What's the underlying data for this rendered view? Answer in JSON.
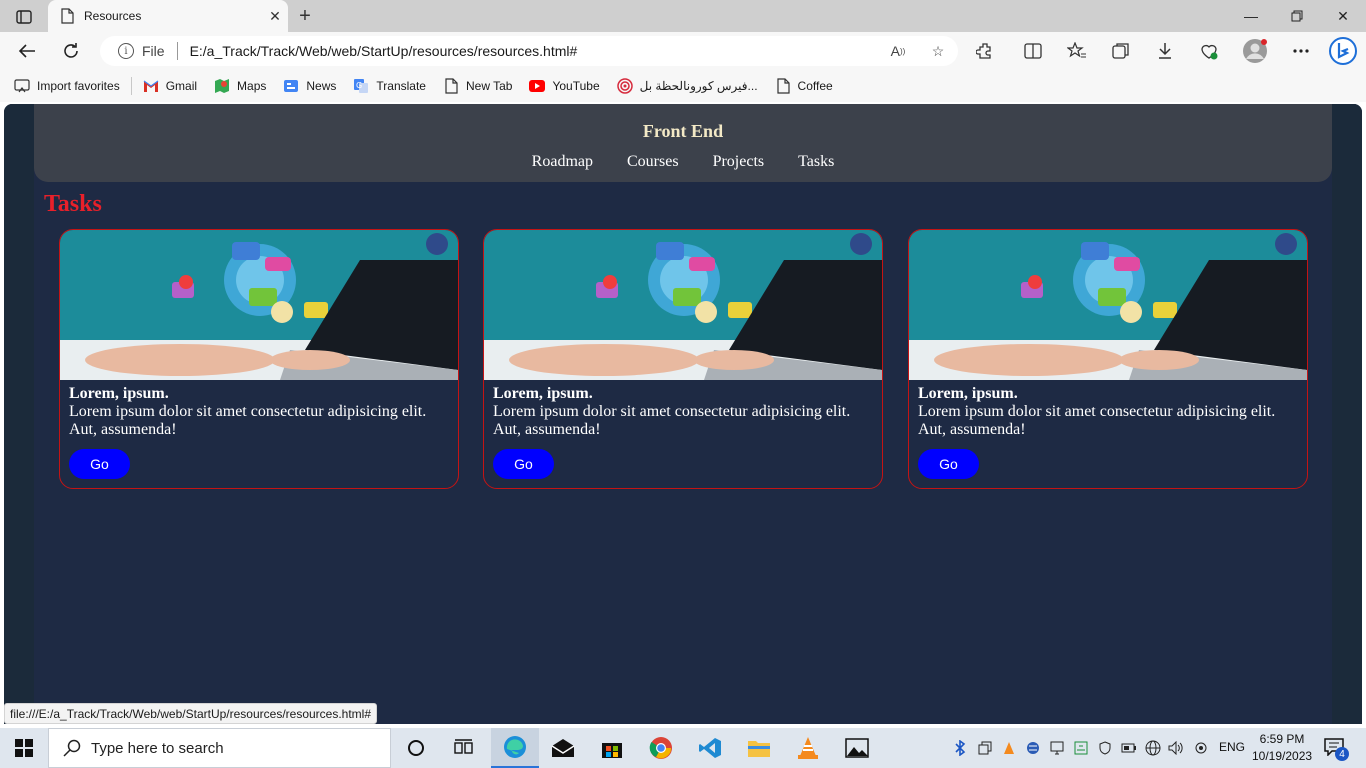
{
  "browser": {
    "tab_title": "Resources",
    "file_label": "File",
    "url": "E:/a_Track/Track/Web/web/StartUp/resources/resources.html#",
    "status_url": "file:///E:/a_Track/Track/Web/web/StartUp/resources/resources.html#"
  },
  "favorites": [
    {
      "label": "Import favorites",
      "icon": "import-icon"
    },
    {
      "label": "Gmail",
      "icon": "gmail-icon"
    },
    {
      "label": "Maps",
      "icon": "maps-icon"
    },
    {
      "label": "News",
      "icon": "news-icon"
    },
    {
      "label": "Translate",
      "icon": "translate-icon"
    },
    {
      "label": "New Tab",
      "icon": "page-icon"
    },
    {
      "label": "YouTube",
      "icon": "youtube-icon"
    },
    {
      "label": "فيرس كورونالحظة بل...",
      "icon": "target-icon"
    },
    {
      "label": "Coffee",
      "icon": "page-icon"
    }
  ],
  "site": {
    "title": "Front End",
    "nav": [
      "Roadmap",
      "Courses",
      "Projects",
      "Tasks"
    ],
    "section_title": "Tasks",
    "cards": [
      {
        "title": "Lorem, ipsum.",
        "text": "Lorem ipsum dolor sit amet consectetur adipisicing elit. Aut, assumenda!",
        "button": "Go"
      },
      {
        "title": "Lorem, ipsum.",
        "text": "Lorem ipsum dolor sit amet consectetur adipisicing elit. Aut, assumenda!",
        "button": "Go"
      },
      {
        "title": "Lorem, ipsum.",
        "text": "Lorem ipsum dolor sit amet consectetur adipisicing elit. Aut, assumenda!",
        "button": "Go"
      }
    ]
  },
  "taskbar": {
    "search_placeholder": "Type here to search",
    "language": "ENG",
    "time": "6:59 PM",
    "date": "10/19/2023",
    "notification_count": "4"
  },
  "colors": {
    "page_bg": "#1e2a44",
    "header_bg": "#3c414b",
    "section_title": "#e8202a",
    "card_border": "#c41414",
    "button_bg": "#0000ff"
  }
}
